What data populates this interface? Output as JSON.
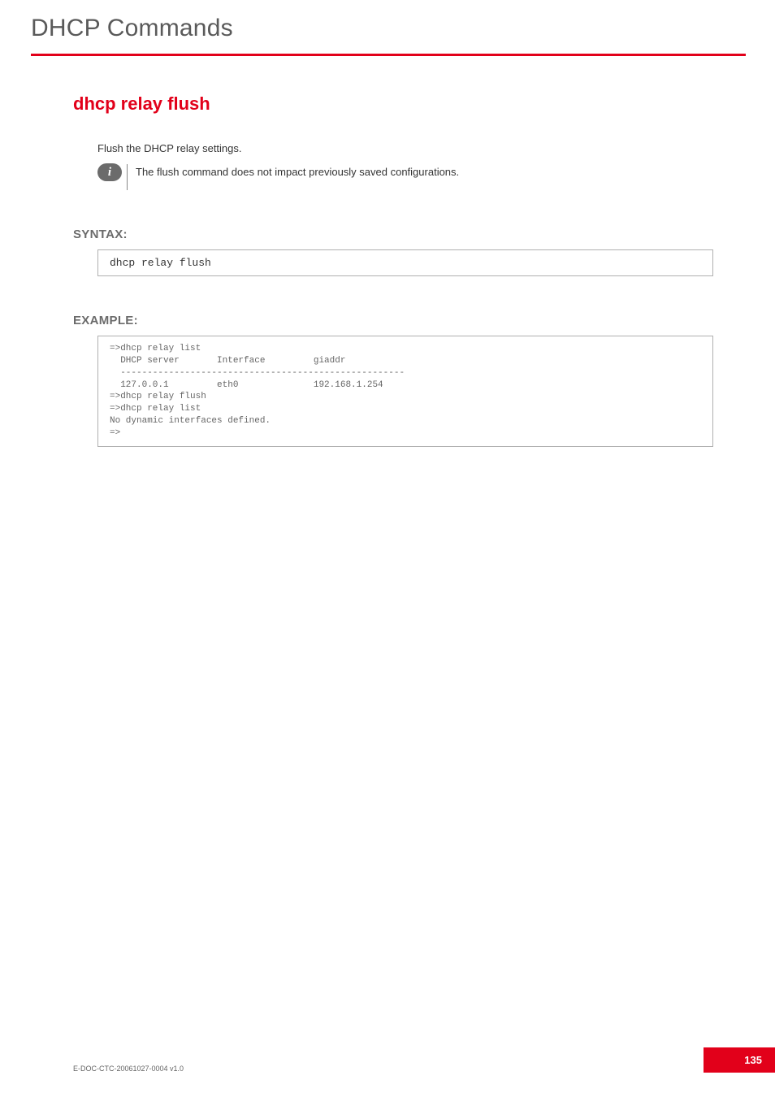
{
  "page": {
    "title": "DHCP Commands",
    "command_heading": "dhcp relay flush",
    "intro": "Flush the DHCP relay settings.",
    "note": "The flush command does not impact previously saved configurations.",
    "syntax_label": "SYNTAX:",
    "syntax_code": "dhcp relay flush",
    "example_label": "EXAMPLE:",
    "example_code": "=>dhcp relay list\n  DHCP server       Interface         giaddr\n  -----------------------------------------------------\n  127.0.0.1         eth0              192.168.1.254\n=>dhcp relay flush\n=>dhcp relay list\nNo dynamic interfaces defined.\n=>",
    "doc_id": "E-DOC-CTC-20061027-0004 v1.0",
    "page_number": "135"
  }
}
